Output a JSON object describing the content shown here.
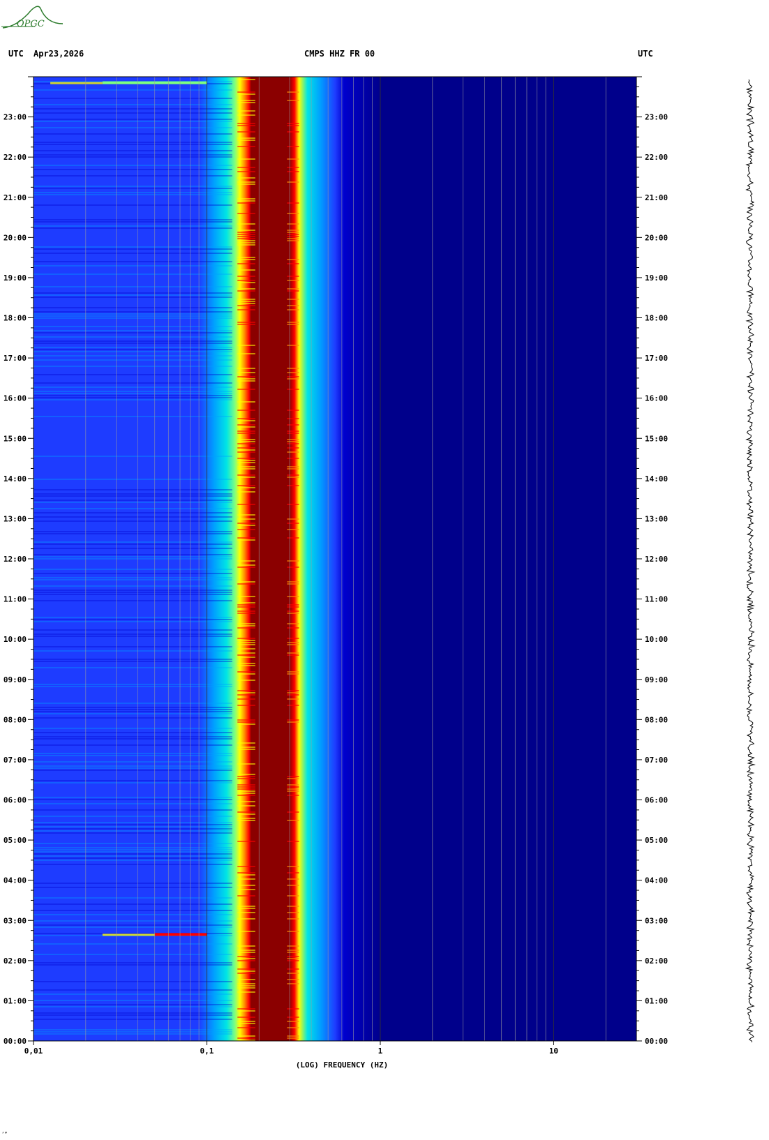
{
  "header": {
    "left_zone": "UTC",
    "date": "Apr23,2026",
    "station": "CMPS HHZ FR 00",
    "right_zone": "UTC"
  },
  "logo": {
    "text": "OPGC",
    "color": "#2a7a2a"
  },
  "footnote": "’”",
  "chart_data": {
    "type": "heatmap",
    "title": "CMPS HHZ FR 00",
    "xlabel": "(LOG) FREQUENCY (HZ)",
    "x_scale": "log",
    "xlim": [
      0.01,
      30
    ],
    "x_ticks": [
      0.01,
      0.1,
      1,
      10
    ],
    "x_tick_labels": [
      "0,01",
      "0,1",
      "1",
      "10"
    ],
    "ylim_hours": [
      0,
      24
    ],
    "y_tick_labels": [
      "00:00",
      "01:00",
      "02:00",
      "03:00",
      "04:00",
      "05:00",
      "06:00",
      "07:00",
      "08:00",
      "09:00",
      "10:00",
      "11:00",
      "12:00",
      "13:00",
      "14:00",
      "15:00",
      "16:00",
      "17:00",
      "18:00",
      "19:00",
      "20:00",
      "21:00",
      "22:00",
      "23:00"
    ],
    "colormap": [
      "#00008b",
      "#0000cd",
      "#1e3cff",
      "#00a0ff",
      "#00e5e5",
      "#7fff7f",
      "#ffff00",
      "#ff8c00",
      "#ff0000",
      "#8b0000"
    ],
    "microseism_peak_hz": [
      0.18,
      0.3
    ],
    "events": [
      {
        "time_hours": 2.65,
        "f_range_hz": [
          0.05,
          0.1
        ],
        "level": "high"
      },
      {
        "time_hours": 23.85,
        "f_range_hz": [
          0.025,
          0.1
        ],
        "level": "medium"
      }
    ],
    "grid": true
  },
  "colors": {
    "background": "#00008b",
    "grid": "#9a9aa0",
    "peak": "#8b0000"
  }
}
